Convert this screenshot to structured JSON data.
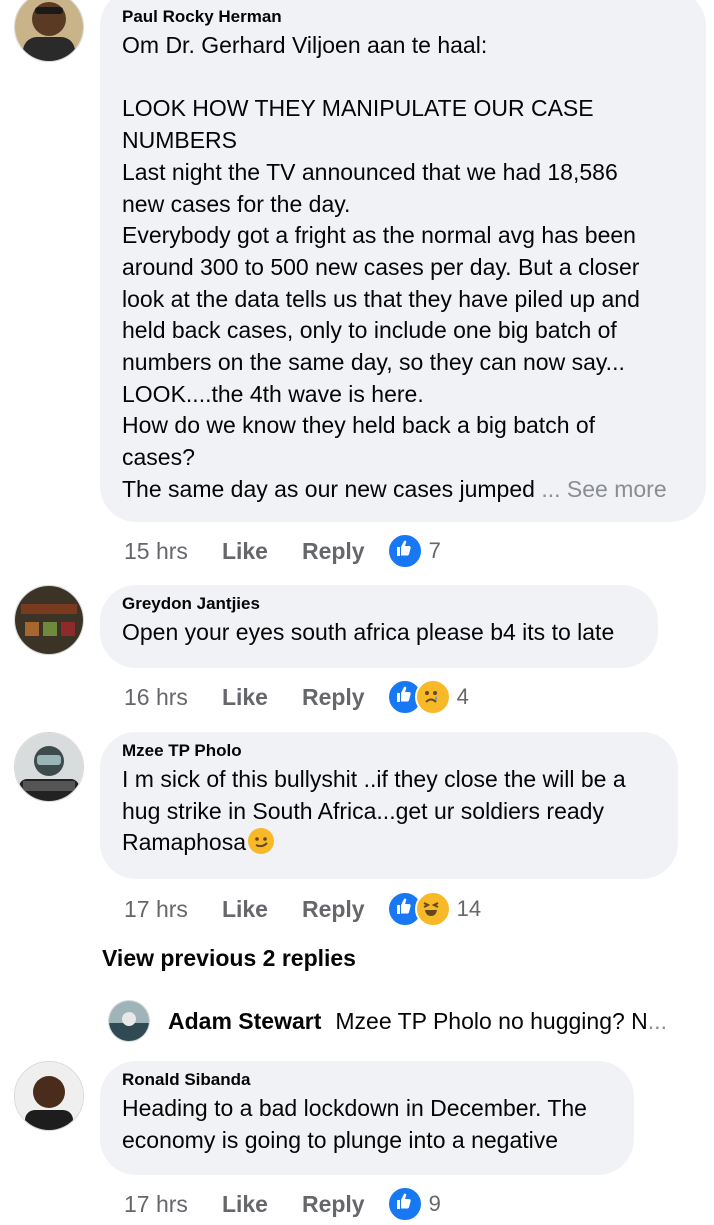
{
  "comments": [
    {
      "author": "Paul Rocky Herman",
      "text": "Om Dr. Gerhard Viljoen aan te haal:\n\nLOOK HOW THEY MANIPULATE OUR CASE\nNUMBERS\nLast night the TV announced that we had 18,586\nnew cases for the day.\nEverybody got a fright as the normal avg has been\naround 300 to 500 new cases per day. But a closer\nlook at the data tells us that they have piled up and\nheld back cases, only to include one big batch of\nnumbers on the same day, so they can now say...\nLOOK....the 4th wave is here.\nHow do we know they held back a big batch of\ncases?\nThe same day as our new cases jumped",
      "see_more": "... See more",
      "time": "15 hrs",
      "like": "Like",
      "reply": "Reply",
      "reaction_count": "7",
      "reactions": [
        "like-icon"
      ]
    },
    {
      "author": "Greydon Jantjies",
      "text": "Open your eyes south africa please b4 its to late",
      "time": "16 hrs",
      "like": "Like",
      "reply": "Reply",
      "reaction_count": "4",
      "reactions": [
        "like-icon",
        "sad-icon"
      ]
    },
    {
      "author": "Mzee TP Pholo",
      "text": "I m sick of this bullyshit ..if they close the will be a\nhug strike in South Africa...get ur soldiers ready\nRamaphosa",
      "time": "17 hrs",
      "like": "Like",
      "reply": "Reply",
      "reaction_count": "14",
      "reactions": [
        "like-icon",
        "haha-icon"
      ]
    },
    {
      "author": "Ronald Sibanda",
      "text": "Heading to a bad lockdown in December. The\neconomy is going to plunge into a negative",
      "time": "17 hrs",
      "like": "Like",
      "reply": "Reply",
      "reaction_count": "9",
      "reactions": [
        "like-icon"
      ]
    }
  ],
  "view_previous": "View previous 2 replies",
  "reply_preview": {
    "author": "Adam Stewart",
    "text": "Mzee TP Pholo no hugging? N",
    "ellipsis": "..."
  },
  "colors": {
    "bubble": "#f0f2f5",
    "like_blue": "#1877f2",
    "meta_gray": "#65676b",
    "emoji_yellow": "#f7b928"
  }
}
